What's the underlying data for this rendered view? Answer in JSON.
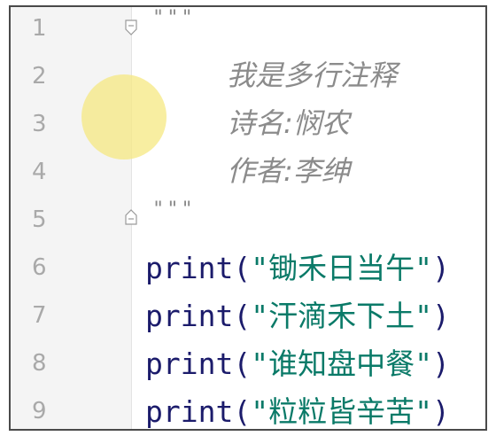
{
  "editor": {
    "line_numbers": [
      "1",
      "2",
      "3",
      "4",
      "5",
      "6",
      "7",
      "8",
      "9"
    ],
    "docstring_open": "\"\"\"",
    "docstring_close": "\"\"\"",
    "comment_lines": [
      "我是多行注释",
      "诗名:悯农",
      "作者:李绅"
    ],
    "code_lines": [
      {
        "func": "print",
        "open": "(",
        "string": "\"锄禾日当午\"",
        "close": ")"
      },
      {
        "func": "print",
        "open": "(",
        "string": "\"汗滴禾下土\"",
        "close": ")"
      },
      {
        "func": "print",
        "open": "(",
        "string": "\"谁知盘中餐\"",
        "close": ")"
      },
      {
        "func": "print",
        "open": "(",
        "string": "\"粒粒皆辛苦\"",
        "close": ")"
      }
    ]
  },
  "colors": {
    "gutter_bg": "#f4f4f4",
    "line_number": "#a9a9a9",
    "comment": "#8b8b8b",
    "keyword": "#1b1b6b",
    "string": "#0a7a68",
    "cursor_highlight": "#f5e882"
  },
  "icons": {
    "fold_start": "fold-collapse-icon",
    "fold_end": "fold-end-icon"
  }
}
